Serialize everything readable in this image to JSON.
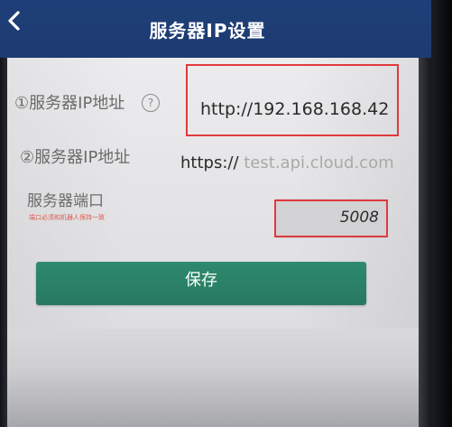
{
  "header": {
    "title": "服务器IP设置",
    "back_icon": "chevron-left-icon"
  },
  "form": {
    "ip_address": {
      "label": "①服务器IP地址",
      "help_icon": "question-circle-icon",
      "help_glyph": "?",
      "value": "http://192.168.168.42"
    },
    "ip_address_2": {
      "label": "②服务器IP地址",
      "value_prefix": "https://",
      "value_rest": " test.api.cloud.com"
    },
    "port": {
      "label": "服务器端口",
      "hint": "端口必须和机器人保持一致",
      "value": "5008"
    }
  },
  "save_button": {
    "label": "保存"
  },
  "colors": {
    "header": "#1f3f78",
    "button": "#2e8a6d",
    "hint": "#e05a4f",
    "highlight_box": "#e0393c"
  }
}
